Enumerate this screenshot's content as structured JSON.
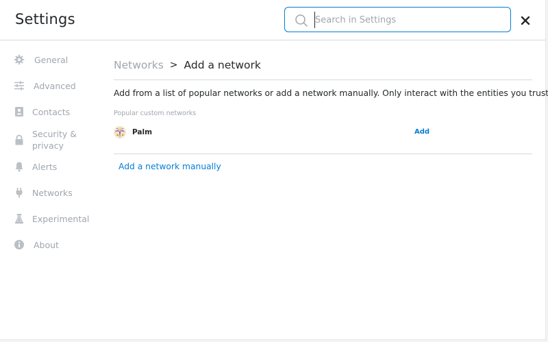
{
  "header": {
    "title": "Settings",
    "search_placeholder": "Search in Settings"
  },
  "sidebar": {
    "items": [
      {
        "label": "General",
        "icon": "gear-icon"
      },
      {
        "label": "Advanced",
        "icon": "sliders-icon"
      },
      {
        "label": "Contacts",
        "icon": "contact-book-icon"
      },
      {
        "label": "Security & privacy",
        "icon": "lock-icon"
      },
      {
        "label": "Alerts",
        "icon": "bell-icon"
      },
      {
        "label": "Networks",
        "icon": "plug-icon"
      },
      {
        "label": "Experimental",
        "icon": "flask-icon"
      },
      {
        "label": "About",
        "icon": "info-icon"
      }
    ]
  },
  "main": {
    "breadcrumb": {
      "parent": "Networks",
      "separator": ">",
      "current": "Add a network"
    },
    "description": "Add from a list of popular networks or add a network manually. Only interact with the entities you trust.",
    "popular_label": "Popular custom networks",
    "networks": [
      {
        "name": "Palm",
        "action": "Add",
        "icon": "palm-logo-icon"
      }
    ],
    "add_manual_label": "Add a network manually"
  },
  "colors": {
    "accent": "#037dd6",
    "muted_text": "#9fa6ae",
    "text": "#24272a",
    "divider": "#d6d9dc"
  }
}
